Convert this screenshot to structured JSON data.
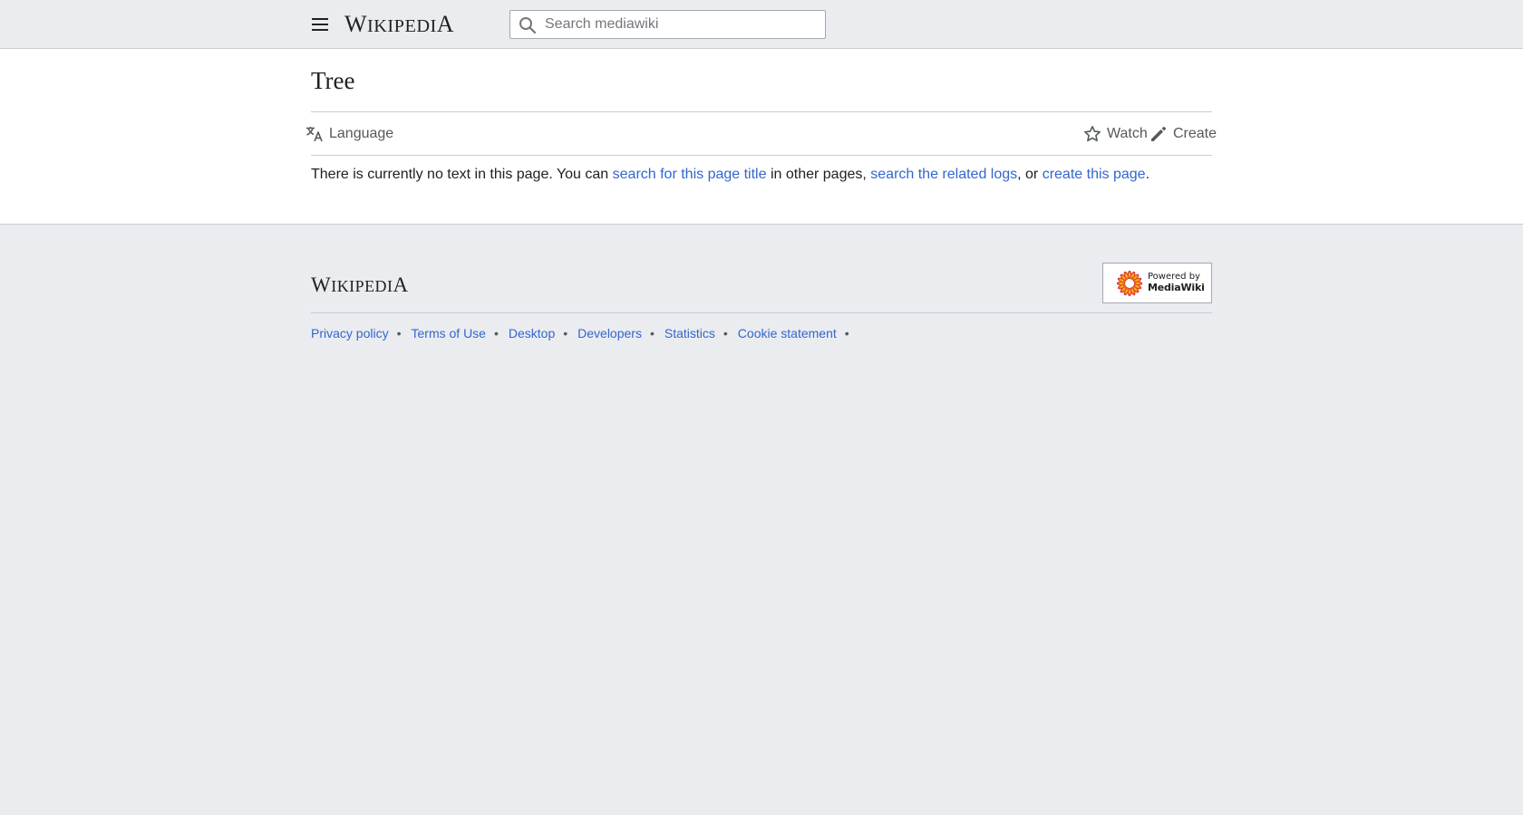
{
  "header": {
    "wordmark": {
      "first": "W",
      "rest": "IKIPEDI",
      "last": "A"
    },
    "search": {
      "placeholder": "Search mediawiki",
      "value": ""
    },
    "menu_icon": "hamburger-menu-icon",
    "search_icon": "search-icon"
  },
  "page": {
    "title": "Tree",
    "toolbar": {
      "language": {
        "label": "Language",
        "icon": "language-icon"
      },
      "watch": {
        "label": "Watch",
        "icon": "star-icon"
      },
      "create": {
        "label": "Create",
        "icon": "pencil-icon"
      }
    },
    "notice": {
      "t1": "There is currently no text in this page. You can ",
      "link1": "search for this page title",
      "t2": " in other pages, ",
      "link2": "search the related logs",
      "t3": ", or ",
      "link3": "create this page",
      "t4": "."
    }
  },
  "footer": {
    "wordmark": {
      "first": "W",
      "rest": "IKIPEDI",
      "last": "A"
    },
    "powered_by": {
      "line1": "Powered by",
      "line2": "MediaWiki"
    },
    "links": [
      {
        "label": "Privacy policy"
      },
      {
        "label": "Terms of Use"
      },
      {
        "label": "Desktop"
      },
      {
        "label": "Developers"
      },
      {
        "label": "Statistics"
      },
      {
        "label": "Cookie statement"
      }
    ],
    "separator": "•"
  },
  "colors": {
    "link": "#3366cc",
    "chrome_bg": "#eaecf0",
    "content_bg": "#ffffff",
    "border": "#c8ccd1",
    "text": "#202122",
    "muted_text": "#54595d"
  }
}
